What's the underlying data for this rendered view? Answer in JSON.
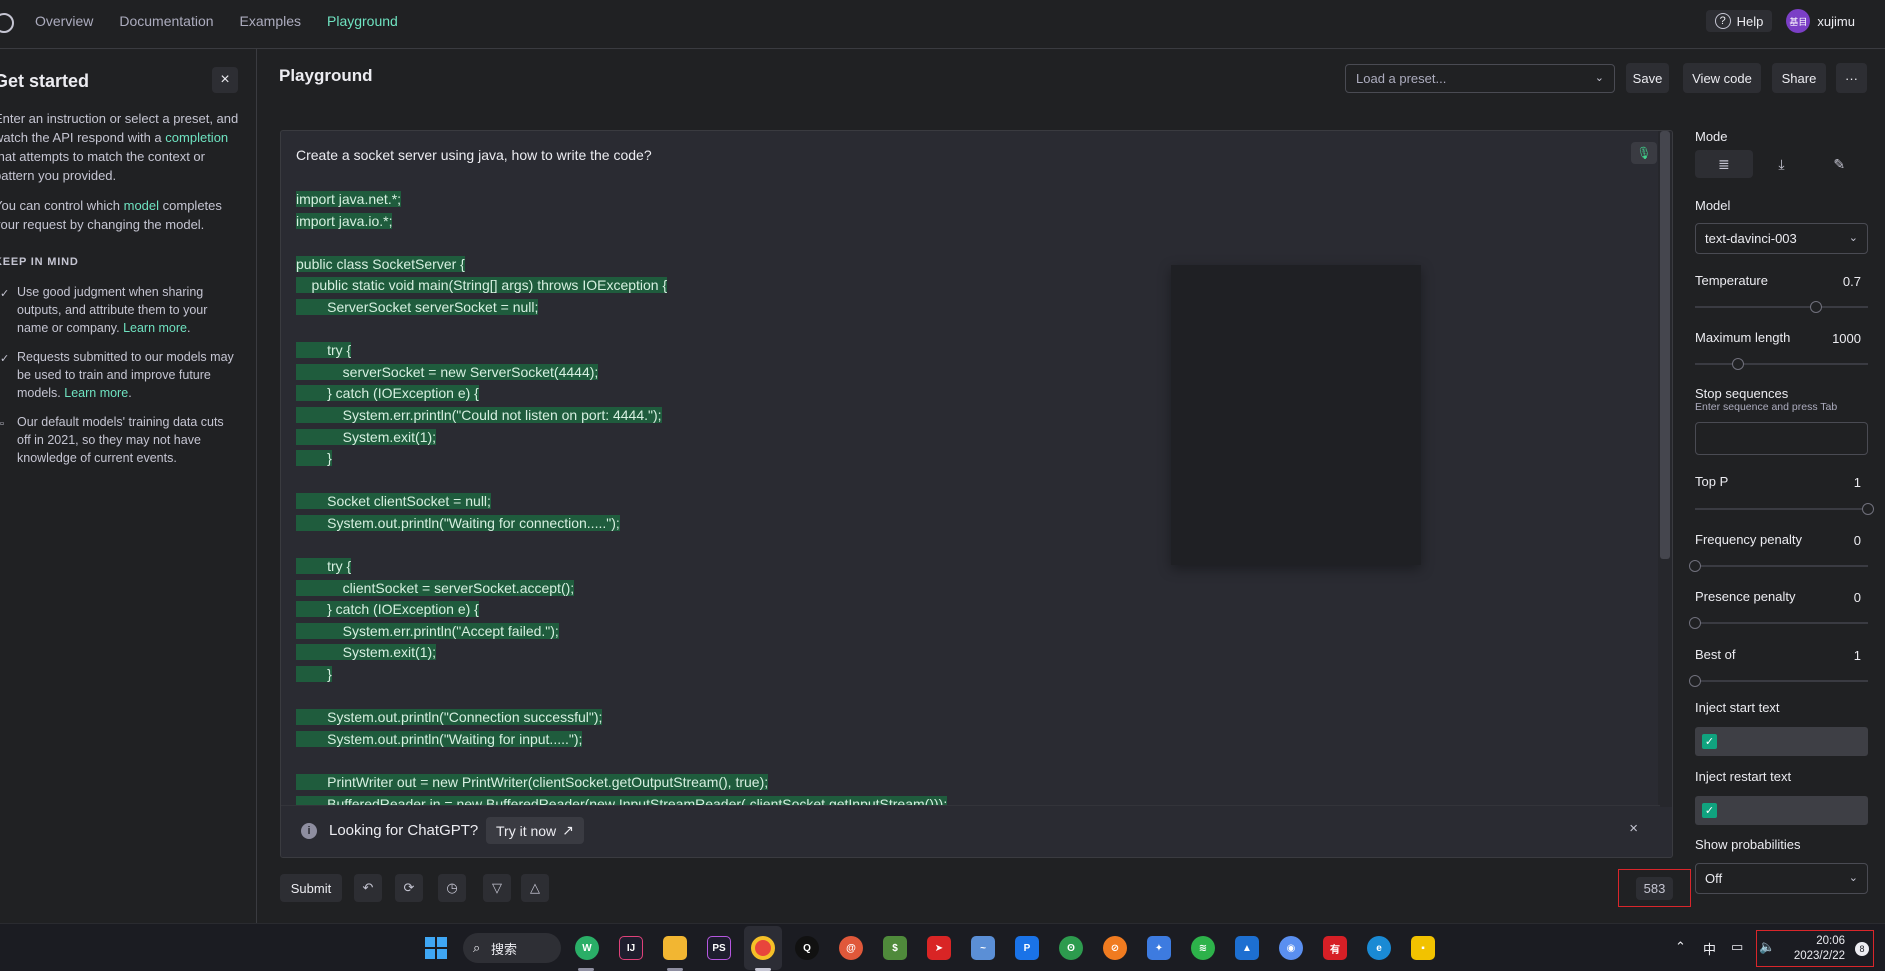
{
  "nav": {
    "links": [
      "Overview",
      "Documentation",
      "Examples",
      "Playground"
    ],
    "help": "Help",
    "avatar_text": "基目",
    "username": "xujimu"
  },
  "left_panel": {
    "title": "Get started",
    "close_icon": "×",
    "para1_a": "Enter an instruction or select a preset, and watch the API respond with a ",
    "para1_link": "completion",
    "para1_b": " that attempts to match the context or pattern you provided.",
    "para2_a": "You can control which ",
    "para2_link": "model",
    "para2_b": " completes your request by changing the model.",
    "keep_in_mind": "KEEP IN MIND",
    "bullets": [
      {
        "text": "Use good judgment when sharing outputs, and attribute them to your name or company. ",
        "link": "Learn more"
      },
      {
        "text": "Requests submitted to our models may be used to train and improve future models. ",
        "link": "Learn more"
      },
      {
        "text": "Our default models' training data cuts off in 2021, so they may not have knowledge of current events.",
        "link": ""
      }
    ]
  },
  "header": {
    "title": "Playground",
    "preset_placeholder": "Load a preset...",
    "save": "Save",
    "view_code": "View code",
    "share": "Share",
    "more": "···"
  },
  "editor": {
    "prompt": "Create a socket server using java, how to write the code?",
    "code_lines": [
      "import java.net.*;",
      "import java.io.*;",
      "",
      "public class SocketServer {",
      "    public static void main(String[] args) throws IOException {",
      "        ServerSocket serverSocket = null;",
      "",
      "        try {",
      "            serverSocket = new ServerSocket(4444);",
      "        } catch (IOException e) {",
      "            System.err.println(\"Could not listen on port: 4444.\");",
      "            System.exit(1);",
      "        }",
      "",
      "        Socket clientSocket = null;",
      "        System.out.println(\"Waiting for connection.....\");",
      "",
      "        try {",
      "            clientSocket = serverSocket.accept();",
      "        } catch (IOException e) {",
      "            System.err.println(\"Accept failed.\");",
      "            System.exit(1);",
      "        }",
      "",
      "        System.out.println(\"Connection successful\");",
      "        System.out.println(\"Waiting for input.....\");",
      "",
      "        PrintWriter out = new PrintWriter(clientSocket.getOutputStream(), true);",
      "        BufferedReader in = new BufferedReader(new InputStreamReader( clientSocket.getInputStream()));"
    ],
    "banner_text": "Looking for ChatGPT?",
    "banner_try": "Try it now",
    "banner_close": "×"
  },
  "actions": {
    "submit": "Submit",
    "token_count": "583"
  },
  "settings": {
    "mode_label": "Mode",
    "model_label": "Model",
    "model_value": "text-davinci-003",
    "temperature_label": "Temperature",
    "temperature_value": "0.7",
    "temperature_fraction": 0.7,
    "max_length_label": "Maximum length",
    "max_length_value": "1000",
    "max_length_fraction": 0.25,
    "stop_label": "Stop sequences",
    "stop_hint": "Enter sequence and press Tab",
    "top_p_label": "Top P",
    "top_p_value": "1",
    "top_p_fraction": 1.0,
    "freq_label": "Frequency penalty",
    "freq_value": "0",
    "freq_fraction": 0.0,
    "presence_label": "Presence penalty",
    "presence_value": "0",
    "presence_fraction": 0.0,
    "best_of_label": "Best of",
    "best_of_value": "1",
    "best_of_fraction": 0.0,
    "inject_start_label": "Inject start text",
    "inject_restart_label": "Inject restart text",
    "show_prob_label": "Show probabilities",
    "show_prob_value": "Off"
  },
  "taskbar": {
    "search": "搜索",
    "ime": "中",
    "time": "20:06",
    "date": "2023/2/22",
    "notifications": "8"
  },
  "colors": {
    "accent": "#6fe3c1",
    "highlight": "#1f5c3d",
    "checkbox": "#10a37f",
    "annotation_red": "#d9262b"
  }
}
